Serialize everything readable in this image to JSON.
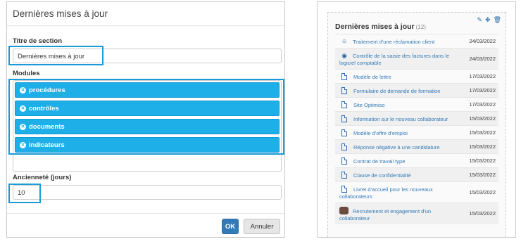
{
  "dialog": {
    "title": "Dernières mises à jour",
    "section_title_label": "Titre de section",
    "section_title_value": "Dernières mises à jour",
    "modules_label": "Modules",
    "modules": [
      "procédures",
      "contrôles",
      "documents",
      "indicateurs"
    ],
    "age_label": "Ancienneté (jours)",
    "age_value": "10",
    "ok_label": "OK",
    "cancel_label": "Annuler"
  },
  "widget": {
    "title": "Dernières mises à jour",
    "count": "(12)",
    "items": [
      {
        "label": "Traitement d'une réclamation client",
        "date": "24/03/2022",
        "icon": "procedure-icon"
      },
      {
        "label": "Contrôle de la saisie des factures dans le logiciel comptable",
        "date": "24/03/2022",
        "icon": "control-icon"
      },
      {
        "label": "Modèle de lettre",
        "date": "17/03/2022",
        "icon": "document-icon"
      },
      {
        "label": "Formulaire de demande de formation",
        "date": "17/03/2022",
        "icon": "document-icon"
      },
      {
        "label": "Site Optimiso",
        "date": "17/03/2022",
        "icon": "document-icon"
      },
      {
        "label": "Information sur le nouveau collaborateur",
        "date": "15/03/2022",
        "icon": "document-icon"
      },
      {
        "label": "Modèle d'offre d'emploi",
        "date": "15/03/2022",
        "icon": "document-icon"
      },
      {
        "label": "Réponse négative à une candidature",
        "date": "15/03/2022",
        "icon": "document-icon"
      },
      {
        "label": "Contrat de travail type",
        "date": "15/03/2022",
        "icon": "document-icon"
      },
      {
        "label": "Clause de confidentialité",
        "date": "15/03/2022",
        "icon": "document-icon"
      },
      {
        "label": "Livret d'accueil pour les nouveaux collaborateurs",
        "date": "15/03/2022",
        "icon": "document-icon"
      },
      {
        "label": "Recrutement et engagement d'un collaborateur",
        "date": "15/03/2022",
        "icon": "avatar-icon"
      }
    ]
  },
  "colors": {
    "accent": "#1eaee8",
    "highlight": "#1a9ad6",
    "primary": "#337ab7"
  }
}
